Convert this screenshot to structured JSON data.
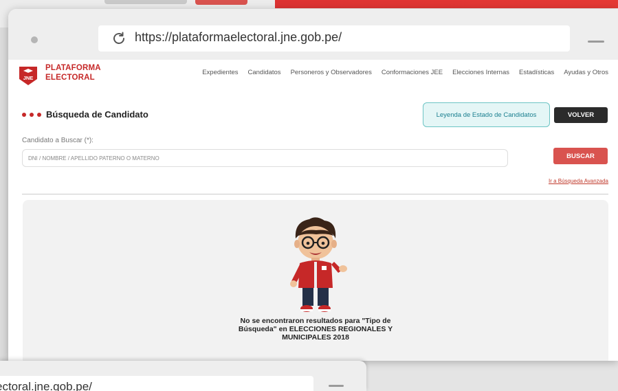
{
  "browser": {
    "url": "https://plataformaelectoral.jne.gob.pe/",
    "url_partial": "ectoral.jne.gob.pe/"
  },
  "brand": {
    "badge": "JNE",
    "line1": "PLATAFORMA",
    "line2": "ELECTORAL"
  },
  "nav": {
    "items": [
      "Expedientes",
      "Candidatos",
      "Personeros y Observadores",
      "Conformaciones JEE",
      "Elecciones Internas",
      "Estadísticas",
      "Ayudas y Otros"
    ]
  },
  "page": {
    "title": "Búsqueda de Candidato",
    "legend_button": "Leyenda de Estado de Candidatos",
    "back_button": "VOLVER"
  },
  "search": {
    "label": "Candidato a Buscar (*):",
    "placeholder": "DNI / NOMBRE / APELLIDO PATERNO O MATERNO",
    "button": "BUSCAR",
    "advanced_link": "Ir a Búsqueda Avanzada"
  },
  "results": {
    "message_line1": "No se encontraron resultados para \"Tipo de",
    "message_line2": "Búsqueda\" en ELECCIONES REGIONALES Y",
    "message_line3": "MUNICIPALES 2018"
  },
  "colors": {
    "brand_red": "#c62828",
    "button_red": "#d9534f",
    "teal": "#1a7f8f",
    "dark": "#2b2b2b"
  },
  "icons": [
    "reload-icon",
    "minimize-icon",
    "jne-logo-icon",
    "mascot-illustration"
  ]
}
